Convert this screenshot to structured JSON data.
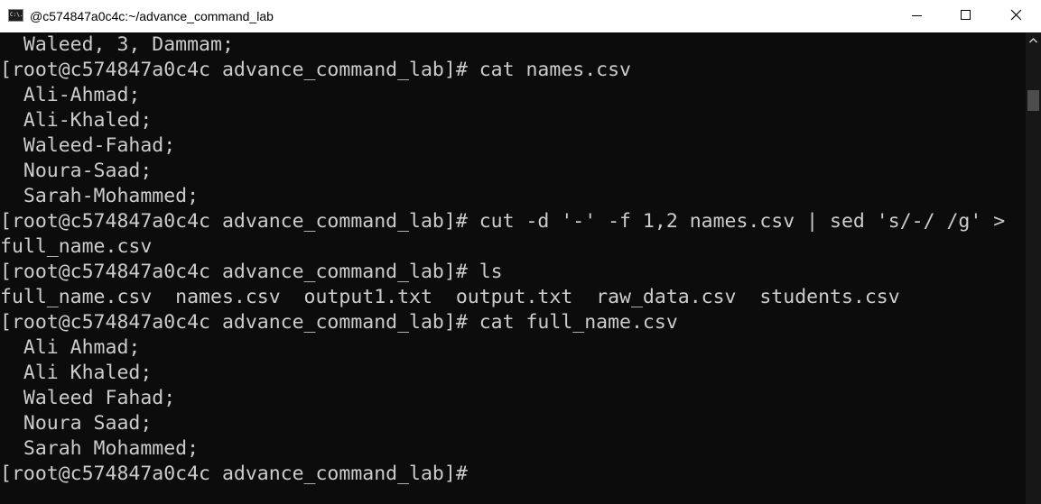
{
  "window": {
    "title": "@c574847a0c4c:~/advance_command_lab",
    "app_icon_text": "C:\\."
  },
  "icons": {
    "app": "command-prompt-icon",
    "minimize": "minimize-icon",
    "maximize": "maximize-icon",
    "close": "close-icon",
    "scroll_up": "chevron-up-icon"
  },
  "colors": {
    "terminal_background": "#0c0c0c",
    "terminal_text": "#cccccc",
    "titlebar_background": "#ffffff"
  },
  "terminal": {
    "lines": [
      "  Waleed, 3, Dammam;",
      "[root@c574847a0c4c advance_command_lab]# cat names.csv",
      "  Ali-Ahmad;",
      "  Ali-Khaled;",
      "  Waleed-Fahad;",
      "  Noura-Saad;",
      "  Sarah-Mohammed;",
      "[root@c574847a0c4c advance_command_lab]# cut -d '-' -f 1,2 names.csv | sed 's/-/ /g' >",
      "full_name.csv",
      "[root@c574847a0c4c advance_command_lab]# ls",
      "full_name.csv  names.csv  output1.txt  output.txt  raw_data.csv  students.csv",
      "[root@c574847a0c4c advance_command_lab]# cat full_name.csv",
      "  Ali Ahmad;",
      "  Ali Khaled;",
      "  Waleed Fahad;",
      "  Noura Saad;",
      "  Sarah Mohammed;",
      "[root@c574847a0c4c advance_command_lab]#"
    ]
  }
}
